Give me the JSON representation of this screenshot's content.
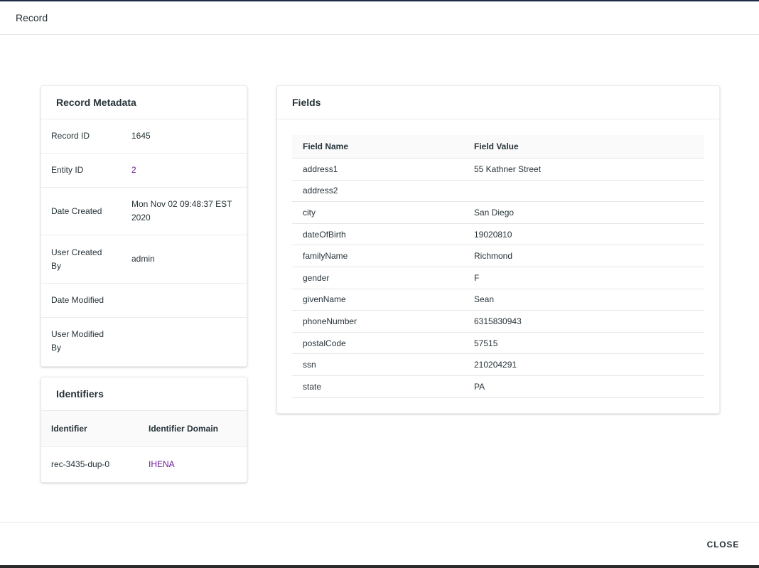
{
  "dialog": {
    "title": "Record",
    "close_label": "CLOSE"
  },
  "metadata": {
    "title": "Record Metadata",
    "rows": [
      {
        "label": "Record ID",
        "value": "1645"
      },
      {
        "label": "Entity ID",
        "value": "2"
      },
      {
        "label": "Date Created",
        "value": "Mon Nov 02 09:48:37 EST 2020"
      },
      {
        "label": "User Created By",
        "value": "admin"
      },
      {
        "label": "Date Modified",
        "value": ""
      },
      {
        "label": "User Modified By",
        "value": ""
      }
    ]
  },
  "identifiers": {
    "title": "Identifiers",
    "columns": [
      "Identifier",
      "Identifier Domain"
    ],
    "rows": [
      {
        "identifier": "rec-3435-dup-0",
        "domain": "IHENA"
      }
    ]
  },
  "fields": {
    "title": "Fields",
    "columns": [
      "Field Name",
      "Field Value"
    ],
    "rows": [
      {
        "name": "address1",
        "value": "55 Kathner Street"
      },
      {
        "name": "address2",
        "value": ""
      },
      {
        "name": "city",
        "value": "San Diego"
      },
      {
        "name": "dateOfBirth",
        "value": "19020810"
      },
      {
        "name": "familyName",
        "value": "Richmond"
      },
      {
        "name": "gender",
        "value": "F"
      },
      {
        "name": "givenName",
        "value": "Sean"
      },
      {
        "name": "phoneNumber",
        "value": "6315830943"
      },
      {
        "name": "postalCode",
        "value": "57515"
      },
      {
        "name": "ssn",
        "value": "210204291"
      },
      {
        "name": "state",
        "value": "PA"
      }
    ]
  },
  "colors": {
    "link": "#6a1b9a",
    "text": "#263238"
  }
}
